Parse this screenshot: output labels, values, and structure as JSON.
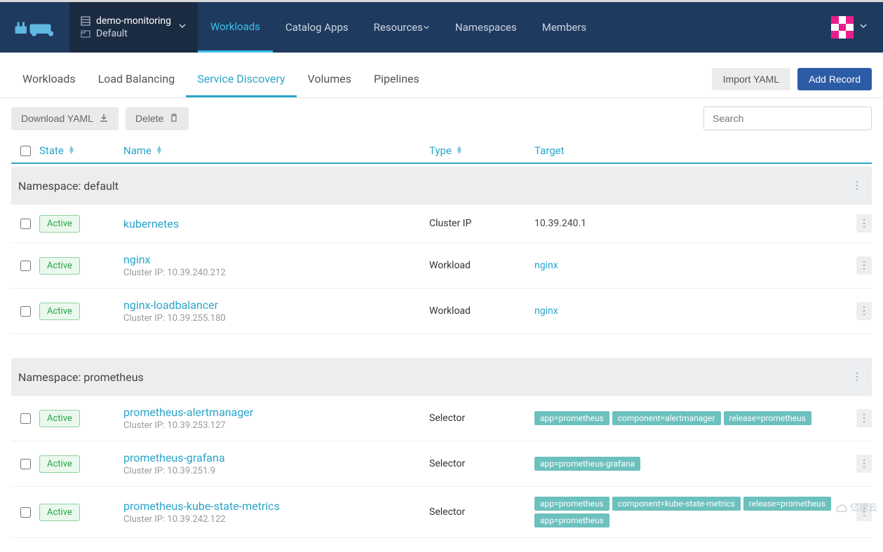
{
  "header": {
    "cluster_name": "demo-monitoring",
    "project_name": "Default",
    "nav": [
      "Workloads",
      "Catalog Apps",
      "Resources",
      "Namespaces",
      "Members"
    ],
    "active_nav": 0
  },
  "subnav": {
    "tabs": [
      "Workloads",
      "Load Balancing",
      "Service Discovery",
      "Volumes",
      "Pipelines"
    ],
    "active": 2,
    "import_yaml": "Import YAML",
    "add_record": "Add Record"
  },
  "toolbar": {
    "download_yaml": "Download YAML",
    "delete": "Delete",
    "search_placeholder": "Search"
  },
  "columns": {
    "state": "State",
    "name": "Name",
    "type": "Type",
    "target": "Target"
  },
  "groups": [
    {
      "label": "Namespace: default",
      "rows": [
        {
          "state": "Active",
          "name": "kubernetes",
          "sub": "",
          "type": "Cluster IP",
          "target_text": "10.39.240.1",
          "target_link": "",
          "tags": []
        },
        {
          "state": "Active",
          "name": "nginx",
          "sub": "Cluster IP: 10.39.240.212",
          "type": "Workload",
          "target_link": "nginx",
          "target_text": "",
          "tags": []
        },
        {
          "state": "Active",
          "name": "nginx-loadbalancer",
          "sub": "Cluster IP: 10.39.255.180",
          "type": "Workload",
          "target_link": "nginx",
          "target_text": "",
          "tags": []
        }
      ]
    },
    {
      "label": "Namespace: prometheus",
      "rows": [
        {
          "state": "Active",
          "name": "prometheus-alertmanager",
          "sub": "Cluster IP: 10.39.253.127",
          "type": "Selector",
          "target_text": "",
          "target_link": "",
          "tags": [
            "app=prometheus",
            "component=alertmanager",
            "release=prometheus"
          ]
        },
        {
          "state": "Active",
          "name": "prometheus-grafana",
          "sub": "Cluster IP: 10.39.251.9",
          "type": "Selector",
          "target_text": "",
          "target_link": "",
          "tags": [
            "app=prometheus-grafana"
          ]
        },
        {
          "state": "Active",
          "name": "prometheus-kube-state-metrics",
          "sub": "Cluster IP: 10.39.242.122",
          "type": "Selector",
          "target_text": "",
          "target_link": "",
          "tags": [
            "app=prometheus",
            "component=kube-state-metrics",
            "release=prometheus",
            "app=prometheus"
          ]
        }
      ]
    }
  ],
  "watermark": "亿速云"
}
